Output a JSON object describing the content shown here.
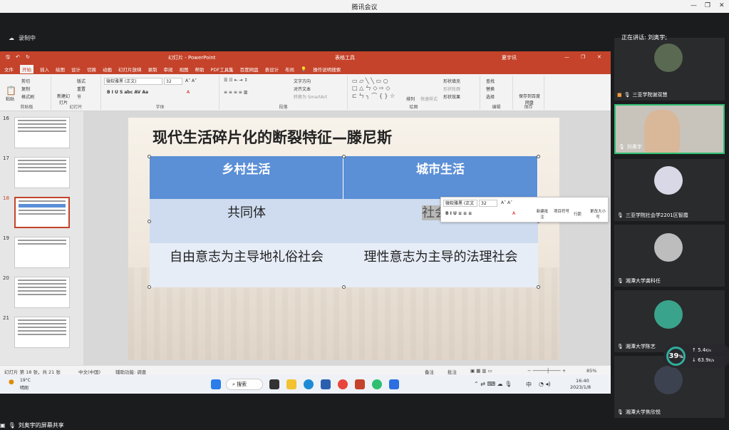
{
  "window": {
    "title": "腾讯会议"
  },
  "recording": {
    "label": "录制中"
  },
  "ppt": {
    "title": "幻灯片 - PowerPoint",
    "tool_context": "表格工具",
    "user": "夏宇讯",
    "tabs": [
      "文件",
      "开始",
      "插入",
      "绘图",
      "设计",
      "切换",
      "动画",
      "幻灯片放映",
      "录制",
      "审阅",
      "视图",
      "帮助",
      "PDF工具集",
      "百度网盘",
      "表设计",
      "布局"
    ],
    "tell_me": "操作说明搜索",
    "ribbon": {
      "clipboard": {
        "label": "剪贴板",
        "paste": "粘贴",
        "cut": "剪切",
        "copy": "复制",
        "format_painter": "格式刷"
      },
      "slides": {
        "label": "幻灯片",
        "new_slide": "新建幻灯片",
        "layout": "版式",
        "reset": "重置",
        "section": "节"
      },
      "font": {
        "label": "字体",
        "name": "微软雅黑 (正文)",
        "size": "32"
      },
      "paragraph": {
        "label": "段落",
        "text_direction": "文字方向",
        "align_text": "对齐文本",
        "smartart": "转换为 SmartArt"
      },
      "drawing": {
        "label": "绘图",
        "arrange": "排列",
        "quick_styles": "快速样式",
        "fill": "形状填充",
        "outline": "形状轮廓",
        "effects": "形状效果"
      },
      "editing": {
        "label": "编辑",
        "find": "查找",
        "replace": "替换",
        "select": "选择"
      },
      "save": {
        "label": "保存",
        "save_to": "保存到百度网盘"
      }
    },
    "thumbnails": [
      {
        "num": "16",
        "selected": false
      },
      {
        "num": "17",
        "selected": false
      },
      {
        "num": "18",
        "selected": true
      },
      {
        "num": "19",
        "selected": false
      },
      {
        "num": "20",
        "selected": false
      },
      {
        "num": "21",
        "selected": false
      }
    ],
    "slide": {
      "title": "现代生活碎片化的断裂特征—滕尼斯",
      "headers": [
        "乡村生活",
        "城市生活"
      ],
      "rows": [
        [
          "共同体",
          "社会"
        ],
        [
          "自由意志为主导地礼俗社会",
          "理性意志为主导的法理社会"
        ]
      ]
    },
    "mini_toolbar": {
      "font": "微软雅黑 (正文",
      "size": "32",
      "new_comment": "新建批注",
      "numbering": "项目符号",
      "line_spacing": "行距",
      "change_case": "更改大小写"
    },
    "status": {
      "slide_info": "幻灯片 第 18 张，共 21 张",
      "language": "中文(中国)",
      "accessibility": "辅助功能: 调查",
      "notes": "备注",
      "comments": "批注",
      "zoom": "85%"
    }
  },
  "taskbar": {
    "weather_temp": "19°C",
    "weather_desc": "晴朗",
    "search": "搜索",
    "time": "16:40",
    "date": "2023/1/8",
    "ime": "中"
  },
  "share_label": "刘奥宇的屏幕共享",
  "speaking": "正在讲话: 刘奥宇;",
  "participants": [
    {
      "name": "三亚学院谢双慧",
      "active": false
    },
    {
      "name": "刘奥宇",
      "active": true
    },
    {
      "name": "三亚学院社会学2201区智霞",
      "active": false
    },
    {
      "name": "湘潭大学龚科任",
      "active": false
    },
    {
      "name": "湘潭大学陈艺",
      "active": false
    },
    {
      "name": "湘潭大学焦欣悦",
      "active": false
    }
  ],
  "network": {
    "percent": "39",
    "unit": "%",
    "up": "5.4",
    "down": "63.9",
    "rate_unit": "K/s"
  },
  "colors": {
    "ppt_red": "#c4432a",
    "header_blue": "#5b8fd6",
    "active_green": "#2fbf71"
  }
}
